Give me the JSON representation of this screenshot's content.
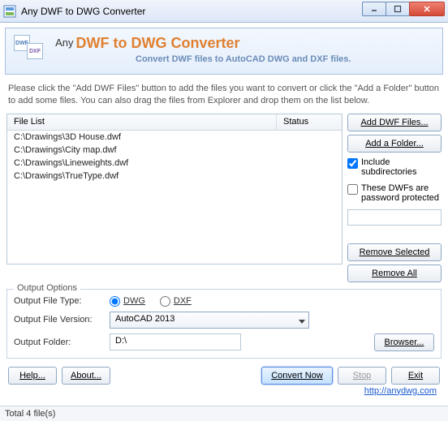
{
  "window": {
    "title": "Any DWF to DWG Converter"
  },
  "hero": {
    "any": "Any",
    "brand": "DWF to DWG Converter",
    "sub": "Convert DWF files to AutoCAD DWG and DXF files.",
    "icon1": "DWF",
    "icon2": "DXF"
  },
  "instructions": "Please click the \"Add DWF Files\" button to add the files you want to convert or click the \"Add a Folder\" button to add some files. You can also drag the files from Explorer and drop them on the list below.",
  "cols": {
    "file": "File List",
    "status": "Status"
  },
  "files": [
    "C:\\Drawings\\3D House.dwf",
    "C:\\Drawings\\City map.dwf",
    "C:\\Drawings\\Lineweights.dwf",
    "C:\\Drawings\\TrueType.dwf"
  ],
  "side": {
    "add_files": "Add DWF Files...",
    "add_folder": "Add a Folder...",
    "include_sub": "Include subdirectories",
    "include_sub_checked": true,
    "pw_protected": "These DWFs are password protected",
    "pw_protected_checked": false,
    "remove_sel": "Remove Selected",
    "remove_all": "Remove All"
  },
  "output": {
    "legend": "Output Options",
    "type_label": "Output File Type:",
    "type_dwg": "DWG",
    "type_dxf": "DXF",
    "type_selected": "DWG",
    "version_label": "Output File Version:",
    "version_value": "AutoCAD 2013",
    "folder_label": "Output Folder:",
    "folder_value": "D:\\",
    "browse": "Browser..."
  },
  "bottom": {
    "help": "Help...",
    "about": "About...",
    "convert": "Convert Now",
    "stop": "Stop",
    "exit": "Exit",
    "link": "http://anydwg.com"
  },
  "statusbar": "Total 4 file(s)"
}
